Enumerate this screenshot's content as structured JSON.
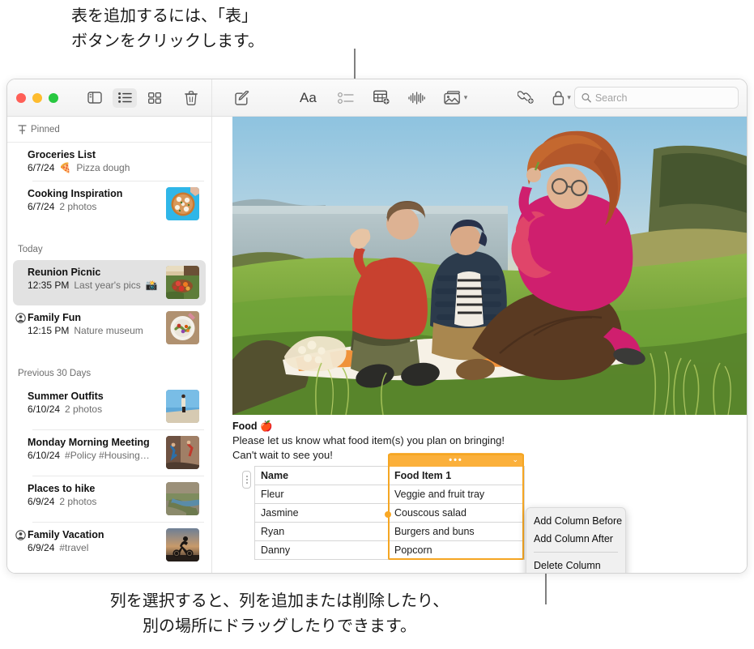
{
  "annotations": {
    "top": "表を追加するには、「表」\nボタンをクリックします。",
    "bottom": "列を選択すると、列を追加または削除したり、\n別の場所にドラッグしたりできます。"
  },
  "toolbar": {
    "window_controls": [
      "close",
      "minimize",
      "zoom"
    ],
    "sidebar_toggle_label": "Sidebar",
    "list_view_label": "List View",
    "gallery_view_label": "Gallery View",
    "delete_label": "Delete",
    "compose_label": "New Note",
    "format_label": "Aa",
    "checklist_label": "Checklist",
    "table_label": "Table",
    "audio_label": "Record Audio",
    "media_label": "Media",
    "collaborate_label": "Collaborate",
    "lock_label": "Lock Note",
    "share_label": "Share"
  },
  "search": {
    "value": "",
    "placeholder": "Search"
  },
  "sidebar": {
    "sections": [
      {
        "title": "Pinned",
        "icon": "pin-icon",
        "notes": [
          {
            "title": "Groceries List",
            "date": "6/7/24",
            "preview": "Pizza dough",
            "emoji": "🍕",
            "thumb": null,
            "locked": false
          },
          {
            "title": "Cooking Inspiration",
            "date": "6/7/24",
            "preview": "2 photos",
            "emoji": "",
            "thumb": "pizza",
            "locked": false
          }
        ]
      },
      {
        "title": "Today",
        "icon": "",
        "notes": [
          {
            "title": "Reunion Picnic",
            "date": "12:35 PM",
            "preview": "Last year's pics",
            "emoji": "📸",
            "thumb": "picnic",
            "locked": false,
            "selected": true
          },
          {
            "title": "Family Fun",
            "date": "12:15 PM",
            "preview": "Nature museum",
            "emoji": "",
            "thumb": "plate",
            "locked": true
          }
        ]
      },
      {
        "title": "Previous 30 Days",
        "icon": "",
        "notes": [
          {
            "title": "Summer Outfits",
            "date": "6/10/24",
            "preview": "2 photos",
            "emoji": "",
            "thumb": "beach",
            "locked": false
          },
          {
            "title": "Monday Morning Meeting",
            "date": "6/10/24",
            "preview": "#Policy #Housing…",
            "emoji": "",
            "thumb": "climb",
            "locked": false
          },
          {
            "title": "Places to hike",
            "date": "6/9/24",
            "preview": "2 photos",
            "emoji": "",
            "thumb": "river",
            "locked": false
          },
          {
            "title": "Family Vacation",
            "date": "6/9/24",
            "preview": "#travel",
            "emoji": "",
            "thumb": "bike",
            "locked": true
          }
        ]
      }
    ]
  },
  "note": {
    "hero_alt": "Three friends sitting on an orange picnic blanket on a grassy coastal bluff at sunset",
    "heading": "Food 🍎",
    "paragraph_line1": "Please let us know what food item(s) you plan on bringing!",
    "paragraph_line2": "Can't wait to see you!",
    "table": {
      "columns": [
        "Name",
        "Food Item 1"
      ],
      "rows": [
        [
          "Fleur",
          "Veggie and fruit tray"
        ],
        [
          "Jasmine",
          "Couscous salad"
        ],
        [
          "Ryan",
          "Burgers and buns"
        ],
        [
          "Danny",
          "Popcorn"
        ]
      ],
      "selected_column_index": 1,
      "selected_column_color": "#fbb03b"
    }
  },
  "context_menu": {
    "items": [
      {
        "label": "Add Column Before",
        "separator_after": false
      },
      {
        "label": "Add Column After",
        "separator_after": true
      },
      {
        "label": "Delete Column",
        "separator_after": false
      }
    ]
  },
  "colors": {
    "accent_orange": "#fbb03b",
    "selected_row": "#e2e2e2",
    "toolbar_bg": "#f4f4f4"
  }
}
